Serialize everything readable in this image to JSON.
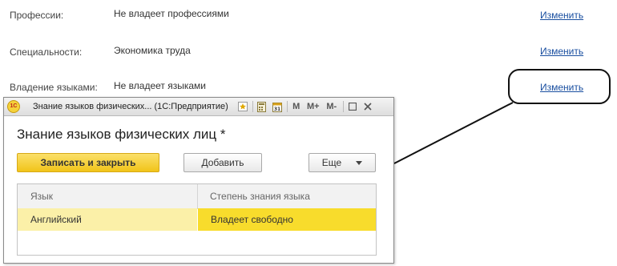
{
  "rows": [
    {
      "label": "Профессии:",
      "value": "Не владеет профессиями",
      "link": "Изменить"
    },
    {
      "label": "Специальности:",
      "value": "Экономика труда",
      "link": "Изменить"
    },
    {
      "label": "Владение языками:",
      "value": "Не владеет языками",
      "link": "Изменить"
    }
  ],
  "dialog": {
    "window_title": "Знание языков физических... (1С:Предприятие)",
    "logo_text": "1С",
    "toolbar_icons": [
      "favorites-star-icon",
      "calculator-icon",
      "calendar-icon",
      "memory-m-icon",
      "memory-plus-icon",
      "memory-minus-icon",
      "maximize-icon",
      "close-icon"
    ],
    "toolbar_labels": {
      "m": "M",
      "m_plus": "M+",
      "m_minus": "M-"
    },
    "form_title": "Знание языков физических лиц *",
    "buttons": {
      "save_close": "Записать и закрыть",
      "add": "Добавить",
      "more": "Еще"
    },
    "table": {
      "columns": [
        "Язык",
        "Степень знания языка"
      ],
      "rows": [
        [
          "Английский",
          "Владеет свободно"
        ]
      ]
    }
  },
  "colors": {
    "link": "#1a4fa0",
    "primary_button": "#f1c419",
    "selected_cell": "#f8dc2c",
    "selected_row": "#fbf0a8"
  }
}
